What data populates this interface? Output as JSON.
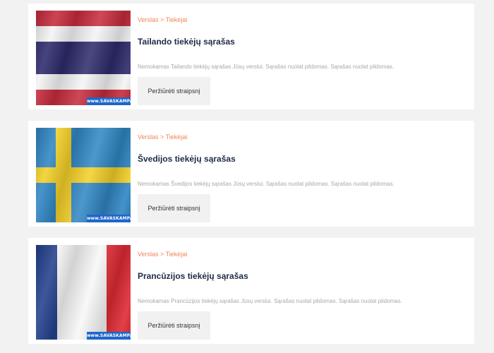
{
  "articles": [
    {
      "breadcrumb": {
        "parent": "Verslas",
        "separator": ">",
        "child": "Tiekėjai"
      },
      "title": "Tailando tiekėjų sąrašas",
      "excerpt": "Nemokamas Tailando tiekėjų sąrašas Jūsų verslui. Sąrašas nuolat pildomas. Sąrašas nuolat pildomas.",
      "button_label": "Peržiūrėti straipsnį",
      "image": {
        "flag": "thailand-flag",
        "watermark": "www.SAVASKAMPAS.lt",
        "colors": [
          "#c62b3c",
          "#ffffff",
          "#2d2a6b"
        ]
      }
    },
    {
      "breadcrumb": {
        "parent": "Verslas",
        "separator": ">",
        "child": "Tiekėjai"
      },
      "title": "Švedijos tiekėjų sąrašas",
      "excerpt": "Nemokamas Švedijos tiekėjų sąrašas Jūsų verslui. Sąrašas nuolat pildomas. Sąrašas nuolat pildomas.",
      "button_label": "Peržiūrėti straipsnį",
      "image": {
        "flag": "sweden-flag",
        "watermark": "www.SAVASKAMPAS.lt",
        "colors": [
          "#2f86c4",
          "#f2cf27"
        ]
      }
    },
    {
      "breadcrumb": {
        "parent": "Verslas",
        "separator": ">",
        "child": "Tiekėjai"
      },
      "title": "Prancūzijos tiekėjų sąrašas",
      "excerpt": "Nemokamas Prancūzijos tiekėjų sąrašas Jūsų verslui. Sąrašas nuolat pildomas. Sąrašas nuolat pildomas.",
      "button_label": "Peržiūrėti straipsnį",
      "image": {
        "flag": "france-flag",
        "watermark": "www.SAVASKAMPAS.lt",
        "colors": [
          "#23408e",
          "#ffffff",
          "#e02a33"
        ]
      }
    }
  ],
  "theme": {
    "accent": "#f0845a",
    "title_color": "#1d2a47",
    "muted_text": "#a8a8a8",
    "page_background": "#f2f2f2"
  }
}
